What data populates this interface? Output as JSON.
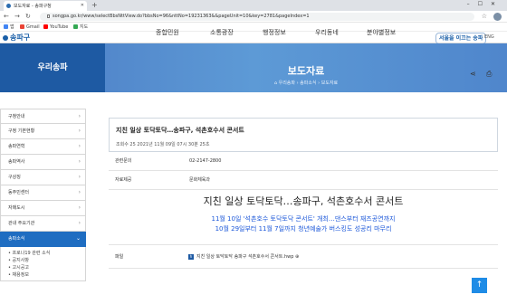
{
  "browser": {
    "tab_title": "보도자료 - 송파구청",
    "url": "songpa.go.kr/www/selectBbsNttView.do?bbsNo=96&nttNo=19231363&&pageUnit=10&key=2781&pageIndex=1",
    "bookmarks": [
      "앱",
      "Gmail",
      "YouTube",
      "지도"
    ]
  },
  "site": {
    "logo": "송파구",
    "gnb": [
      "종합민원",
      "소통광장",
      "행정정보",
      "우리동네",
      "분야별정보"
    ],
    "slogan": "서울을 이끄는 송파",
    "lang": "ENG"
  },
  "banner": {
    "left_title": "우리송파",
    "title": "보도자료",
    "breadcrumb": "⌂ 우리송파 › 송파소식 › 보도자료"
  },
  "sidebar": {
    "items": [
      {
        "label": "구청안내"
      },
      {
        "label": "구정 기본현황"
      },
      {
        "label": "송파연혁"
      },
      {
        "label": "송파역사"
      },
      {
        "label": "구상징"
      },
      {
        "label": "동주민센터"
      },
      {
        "label": "자매도시"
      },
      {
        "label": "관내 주요기관"
      },
      {
        "label": "송파소식"
      }
    ],
    "sub_items": [
      "프로나19 관련 소식",
      "공지사항",
      "고시공고",
      "채용정보"
    ]
  },
  "article": {
    "title": "지친 일상 토닥토닥…송파구, 석촌호수서 콘서트",
    "meta": "조회수 25    2021년 11월 09일 07시 30분 25초",
    "fields": [
      {
        "label": "관련문의",
        "value": "02-2147-2800"
      },
      {
        "label": "자료제공",
        "value": "문화체육과"
      }
    ],
    "body_title": "지친 일상 토닥토닥…송파구, 석촌호수서 콘서트",
    "body_line1": "11월 10일 '석촌호수 토닥토닥 콘서트' 개최…댄스부터 재즈공연까지",
    "body_line2": "10월 29일부터 11월 7일까지 청년예술가 버스킹도 성공리 마무리",
    "attach_label": "파일",
    "attach_file": "지친 일상 토닥토닥 송파구 석촌호수서 콘서트.hwp"
  },
  "icons": {
    "share": "share-icon",
    "print": "print-icon",
    "scroll_top": "arrow-up-icon"
  }
}
